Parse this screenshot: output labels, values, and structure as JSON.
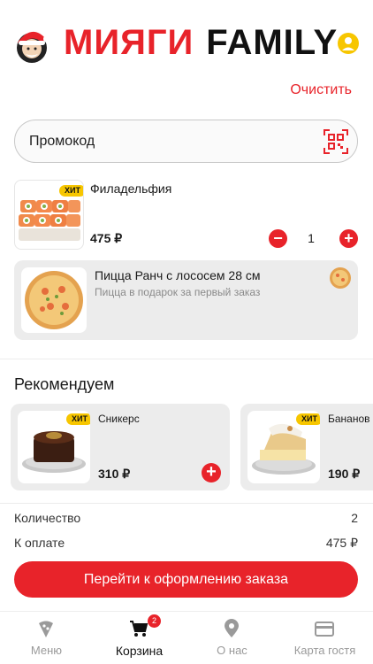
{
  "header": {
    "brand_red": "МИЯГИ",
    "brand_black": "FAMILY"
  },
  "cart": {
    "clear_label": "Очистить",
    "promo_placeholder": "Промокод",
    "items": [
      {
        "name": "Филадельфия",
        "price": "475 ₽",
        "badge": "ХИТ",
        "quantity": "1",
        "minus_glyph": "−",
        "plus_glyph": "+"
      }
    ],
    "gift": {
      "name": "Пицца Ранч с лососем 28 см",
      "subtitle": "Пицца в подарок за первый заказ"
    }
  },
  "recommend": {
    "title": "Рекомендуем",
    "cards": [
      {
        "name": "Сникерс",
        "price": "310 ₽",
        "badge": "ХИТ",
        "add_glyph": "+"
      },
      {
        "name": "Бананов",
        "price": "190 ₽",
        "badge": "ХИТ"
      }
    ]
  },
  "summary": {
    "quantity_label": "Количество",
    "quantity_value": "2",
    "total_label": "К оплате",
    "total_value": "475 ₽",
    "checkout_label": "Перейти к оформлению заказа"
  },
  "tabs": [
    {
      "label": "Меню",
      "icon": "pizza-slice-icon"
    },
    {
      "label": "Корзина",
      "icon": "cart-icon",
      "badge": "2",
      "active": true
    },
    {
      "label": "О нас",
      "icon": "location-pin-icon"
    },
    {
      "label": "Карта гостя",
      "icon": "card-icon"
    }
  ],
  "colors": {
    "accent": "#e8232a",
    "badge": "#f7c600",
    "card_bg": "#ececec"
  }
}
